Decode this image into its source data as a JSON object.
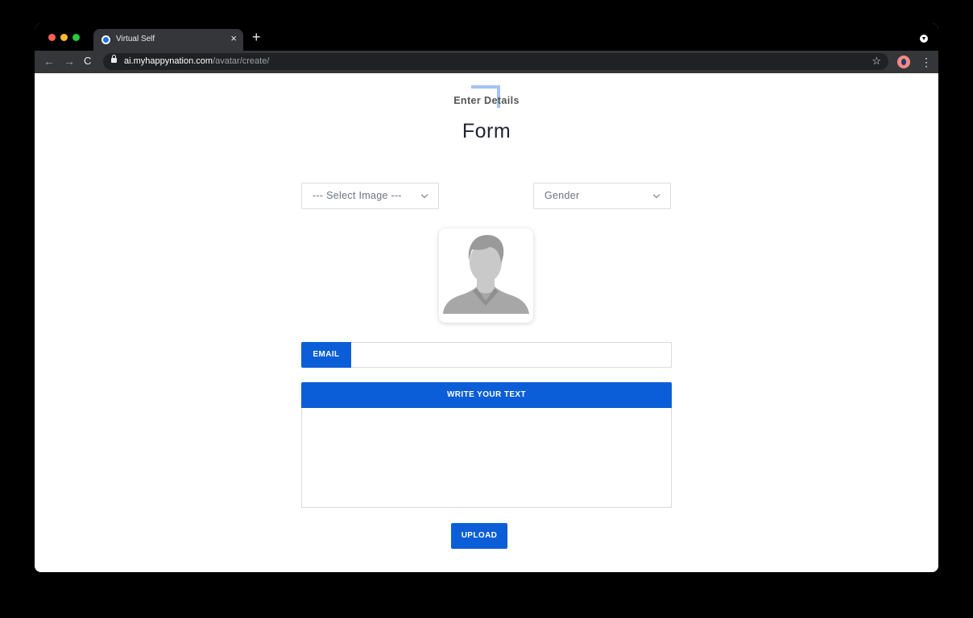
{
  "browser": {
    "tab_title": "Virtual Self",
    "tab_close_glyph": "×",
    "new_tab_glyph": "+",
    "url_host": "ai.myhappynation.com",
    "url_path": "/avatar/create/",
    "nav": {
      "back_glyph": "←",
      "forward_glyph": "→",
      "reload_glyph": "C"
    },
    "star_glyph": "☆",
    "menu_glyph": "⋮"
  },
  "page": {
    "eyebrow": "Enter Details",
    "title": "Form",
    "select_image": {
      "selected": "--- Select Image ---"
    },
    "select_gender": {
      "selected": "Gender"
    },
    "email": {
      "label": "EMAIL",
      "value": ""
    },
    "text_section": {
      "header": "WRITE YOUR TEXT",
      "value": ""
    },
    "upload_button": "UPLOAD"
  },
  "colors": {
    "accent": "#0b5ed7",
    "decoration": "#a4c2f4",
    "title": "#1f2433"
  }
}
